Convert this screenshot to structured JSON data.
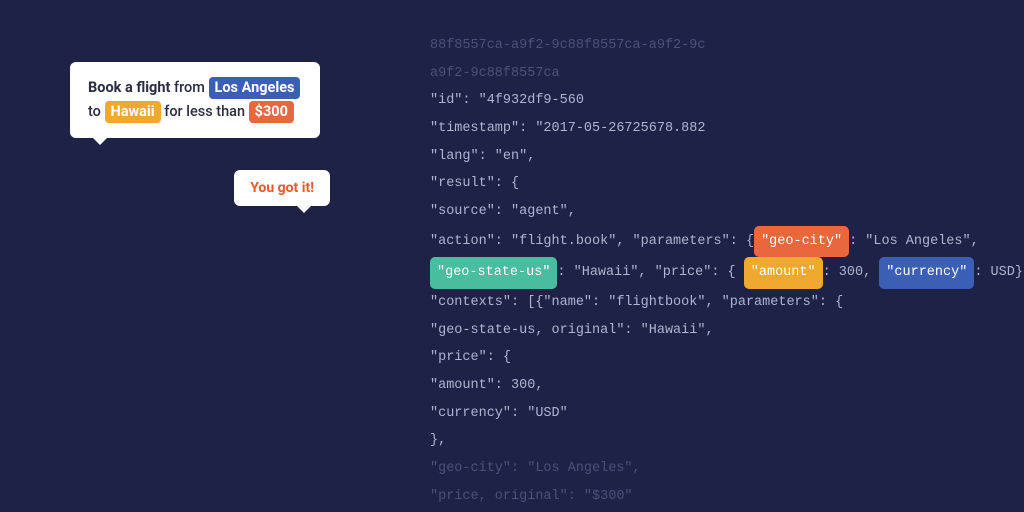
{
  "chat": {
    "user": {
      "pre": "Book a flight",
      "mid1": " from ",
      "loc1": "Los Angeles",
      "mid2": " to ",
      "loc2": "Hawaii",
      "mid3": " for less than ",
      "price": "$300"
    },
    "bot": "You got it!"
  },
  "code": {
    "l1": "88f8557ca-a9f2-9c88f8557ca-a9f2-9c",
    "l2": "a9f2-9c88f8557ca",
    "l3": "\"id\": \"4f932df9-560",
    "l4": "\"timestamp\": \"2017-05-26725678.882",
    "l5": "\"lang\": \"en\",",
    "l6": "\"result\": {",
    "l7": "\"source\": \"agent\",",
    "l8a": "\"action\": \"flight.book\", \"parameters\": {",
    "l8tag": "\"geo-city\"",
    "l8b": ": \"Los Angeles\",",
    "l9tag1": "\"geo-state-us\"",
    "l9a": ": \"Hawaii\", \"price\": {",
    "l9tag2": "\"amount\"",
    "l9b": ": 300, ",
    "l9tag3": "\"currency\"",
    "l9c": ": USD},",
    "l10": "\"contexts\": [{\"name\": \"flightbook\", \"parameters\": {",
    "l11": "\"geo-state-us, original\": \"Hawaii\",",
    "l12": "\"price\": {",
    "l13": "\"amount\": 300,",
    "l14": "\"currency\": \"USD\"",
    "l15": "},",
    "l16": "\"geo-city\": \"Los Angeles\",",
    "l17": "\"price, original\": \"$300\""
  }
}
